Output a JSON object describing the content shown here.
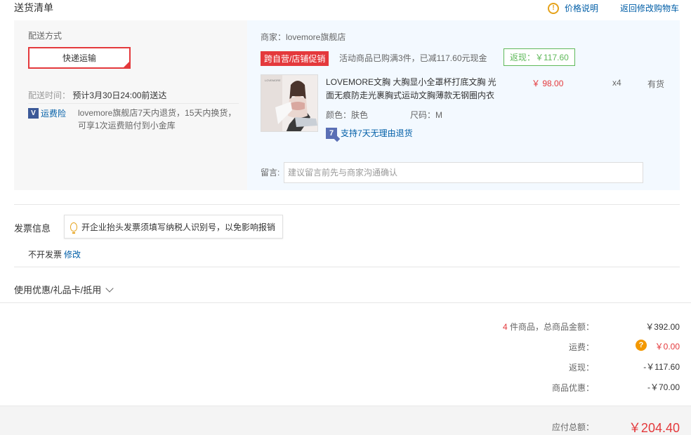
{
  "header": {
    "title": "送货清单",
    "price_help": "价格说明",
    "price_help_icon": "!",
    "back_to_cart": "返回修改购物车"
  },
  "shipping": {
    "method_label": "配送方式",
    "method_value": "快递运输",
    "time_label": "配送时间：",
    "time_value": "预计3月30日24:00前送达",
    "insurance_badge": "运费险",
    "insurance_icon": "V",
    "insurance_text": "lovemore旗舰店7天内退货，15天内换货，可享1次运费赔付到小金库"
  },
  "order": {
    "seller": "商家：lovemore旗舰店",
    "promo_tag": "跨自营/店铺促销",
    "promo_desc": "活动商品已购满3件，已减117.60元现金",
    "cashback": "返现：￥117.60",
    "product": {
      "name": "LOVEMORE文胸 大胸显小全罩杯打底文胸 光面无痕防走光裹胸式运动文胸薄款无钢圈内衣",
      "price": "￥ 98.00",
      "qty": "x4",
      "stock": "有货",
      "color": "颜色：肤色",
      "size": "尺码：M",
      "return_policy": "支持7天无理由退货",
      "return_icon": "7",
      "image_brand": "LOVEMORE"
    },
    "note_label": "留言:",
    "note_placeholder": "建议留言前先与商家沟通确认"
  },
  "invoice": {
    "title": "发票信息",
    "tip": "开企业抬头发票须填写纳税人识别号，以免影响报销",
    "status": "不开发票",
    "edit": "修改"
  },
  "coupon": {
    "label": "使用优惠/礼品卡/抵用"
  },
  "summary": {
    "count": "4",
    "count_label": " 件商品，总商品金额：",
    "goods_total": "￥392.00",
    "freight_label": "运费：",
    "freight_icon": "?",
    "freight": "￥0.00",
    "cashback_label": "返现：",
    "cashback": "-￥117.60",
    "discount_label": "商品优惠：",
    "discount": "-￥70.00",
    "payable_label": "应付总额：",
    "payable": "￥204.40"
  },
  "colors": {
    "accent_red": "#e4393c",
    "link_blue": "#005ea7",
    "cashback_green": "#5fb95a",
    "panel_blue": "#f3f9ff"
  }
}
